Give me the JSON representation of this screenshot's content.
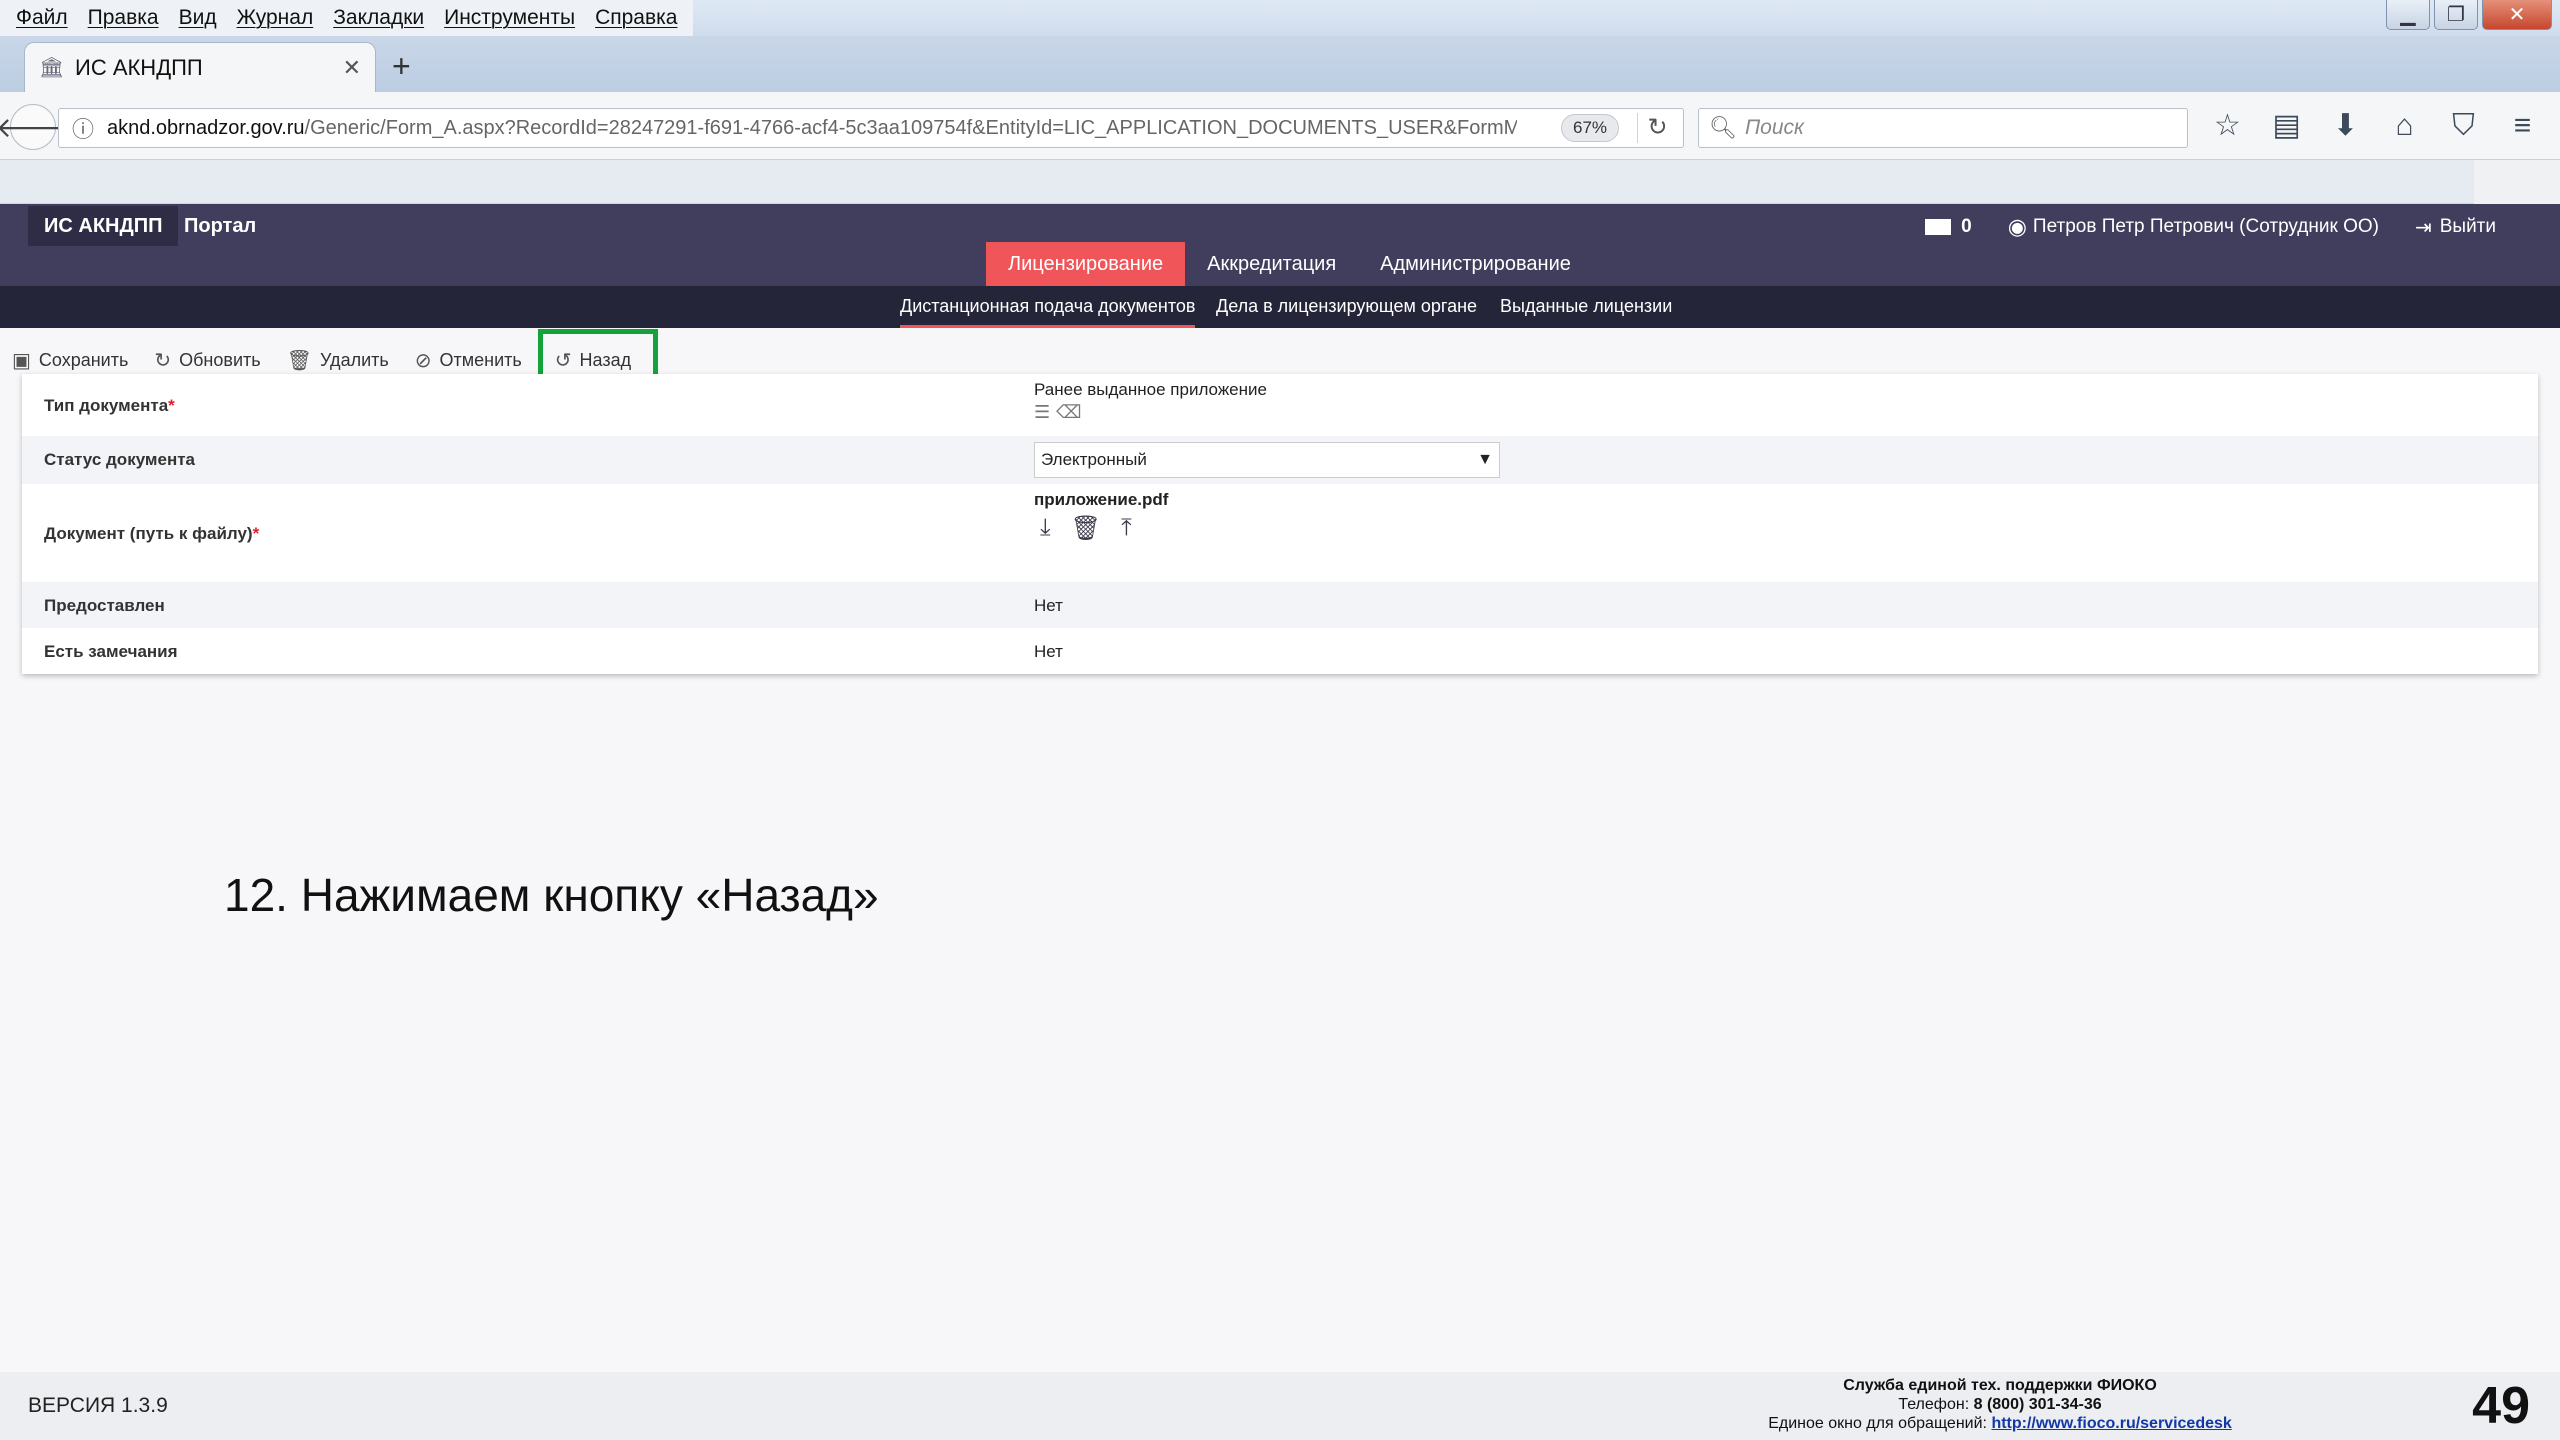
{
  "browser": {
    "menu": [
      "Файл",
      "Правка",
      "Вид",
      "Журнал",
      "Закладки",
      "Инструменты",
      "Справка"
    ],
    "tab_title": "ИС АКНДПП",
    "url_domain": "aknd.obrnadzor.gov.ru",
    "url_path": "/Generic/Form_A.aspx?RecordId=28247291-f691-4766-acf4-5c3aa109754f&EntityId=LIC_APPLICATION_DOCUMENTS_USER&FormMode=",
    "zoom": "67%",
    "search_placeholder": "Поиск"
  },
  "app": {
    "brand": "ИС АКНДПП",
    "portal": "Портал",
    "messages_count": "0",
    "user": "Петров Петр Петрович (Сотрудник ОО)",
    "logout": "Выйти",
    "main_tabs": [
      "Лицензирование",
      "Аккредитация",
      "Администрирование"
    ],
    "sub_tabs": [
      "Дистанционная подача документов",
      "Дела в лицензирующем органе",
      "Выданные лицензии"
    ]
  },
  "toolbar": {
    "save": "Сохранить",
    "refresh": "Обновить",
    "delete": "Удалить",
    "cancel": "Отменить",
    "back": "Назад"
  },
  "form": {
    "doc_type_label": "Тип документа",
    "doc_type_value": "Ранее выданное приложение",
    "status_label": "Статус документа",
    "status_value": "Электронный",
    "file_label": "Документ (путь к файлу)",
    "file_name": "приложение.pdf",
    "provided_label": "Предоставлен",
    "provided_value": "Нет",
    "remarks_label": "Есть замечания",
    "remarks_value": "Нет",
    "required_mark": "*"
  },
  "caption": "12. Нажимаем кнопку «Назад»",
  "footer": {
    "version": "ВЕРСИЯ 1.3.9",
    "support_title": "Служба единой тех. поддержки ФИОКО",
    "phone_label": "Телефон:",
    "phone": "8 (800) 301-34-36",
    "window_label": "Единое окно для обращений:",
    "window_link": "http://www.fioco.ru/servicedesk"
  },
  "page_number": "49",
  "colors": {
    "header_bg": "#403e5c",
    "subnav_bg": "#25253a",
    "accent_red": "#f0555a",
    "highlight_green": "#14a33a"
  }
}
